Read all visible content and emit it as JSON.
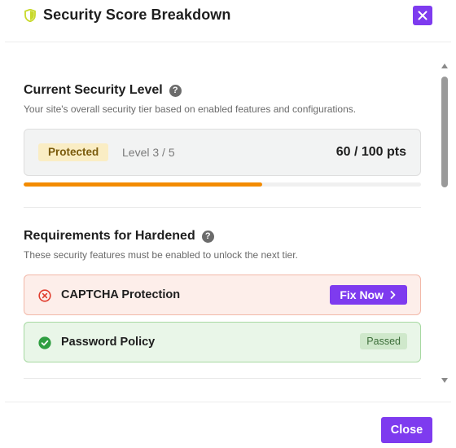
{
  "modal": {
    "title": "Security Score Breakdown",
    "title_icon": "shield-icon",
    "close_icon": "close-icon"
  },
  "current_level": {
    "title": "Current Security Level",
    "help_icon": "help-circle-icon",
    "help_glyph": "?",
    "description": "Your site's overall security tier based on enabled features and configurations.",
    "badge": "Protected",
    "level_text": "Level 3 / 5",
    "points_text": "60 / 100 pts",
    "progress_fraction": 0.6
  },
  "requirements": {
    "title": "Requirements for Hardened",
    "help_icon": "help-circle-icon",
    "help_glyph": "?",
    "description": "These security features must be enabled to unlock the next tier.",
    "items": [
      {
        "label": "CAPTCHA Protection",
        "status": "fail",
        "icon": "error-circle-icon",
        "action_label": "Fix Now",
        "action_icon": "chevron-right-icon"
      },
      {
        "label": "Password Policy",
        "status": "pass",
        "icon": "check-circle-icon",
        "badge": "Passed"
      }
    ]
  },
  "footer": {
    "close_label": "Close"
  },
  "colors": {
    "accent": "#7e3bef",
    "progress": "#f38b00",
    "protected_badge_bg": "#faedc4",
    "fail_bg": "#fdeeea",
    "pass_bg": "#e9f6e8"
  }
}
